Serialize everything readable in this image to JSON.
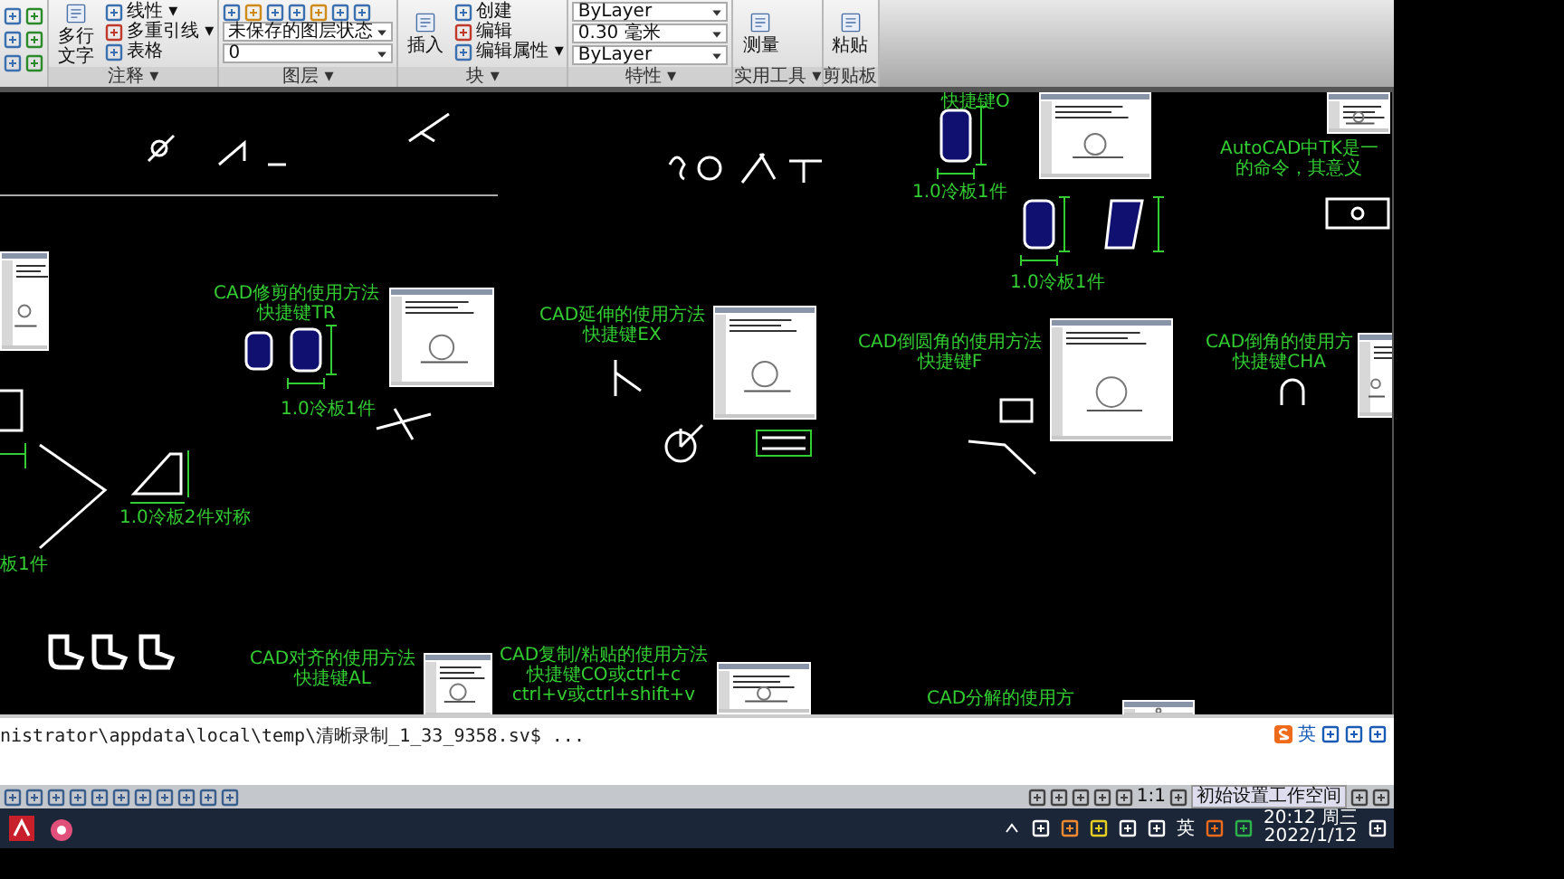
{
  "ribbon": {
    "panels": [
      {
        "title": "注释 ▾",
        "icon_row": false,
        "items": [
          {
            "kind": "large",
            "label": "多行文字"
          },
          {
            "kind": "small",
            "label": "线性 ▾"
          },
          {
            "kind": "small",
            "label": "多重引线 ▾"
          },
          {
            "kind": "small",
            "label": "表格"
          }
        ]
      },
      {
        "title": "图层 ▾",
        "icon_row": true,
        "items": [
          {
            "kind": "dropdown",
            "label": "未保存的图层状态"
          },
          {
            "kind": "dropdown",
            "label": "0"
          }
        ]
      },
      {
        "title": "块 ▾",
        "icon_row": false,
        "items": [
          {
            "kind": "large",
            "label": "插入"
          },
          {
            "kind": "small",
            "label": "创建"
          },
          {
            "kind": "small",
            "label": "编辑"
          },
          {
            "kind": "small",
            "label": "编辑属性 ▾"
          }
        ]
      },
      {
        "title": "特性 ▾",
        "icon_row": false,
        "items": [
          {
            "kind": "dropdown",
            "label": "ByLayer"
          },
          {
            "kind": "dropdown",
            "label": "0.30 毫米"
          },
          {
            "kind": "dropdown",
            "label": "ByLayer"
          }
        ]
      },
      {
        "title": "实用工具 ▾",
        "icon_row": false,
        "items": [
          {
            "kind": "large",
            "label": "测量"
          }
        ]
      },
      {
        "title": "剪贴板",
        "icon_row": false,
        "items": [
          {
            "kind": "large",
            "label": "粘贴"
          }
        ]
      }
    ]
  },
  "canvas": {
    "labels": [
      {
        "lines": [
          "快捷键O"
        ]
      },
      {
        "lines": [
          "1.0冷板1件"
        ]
      },
      {
        "lines": [
          "1.0冷板1件"
        ]
      },
      {
        "lines": [
          "AutoCAD中TK是一",
          "的命令，其意义"
        ]
      },
      {
        "lines": [
          "CAD修剪的使用方法",
          "快捷键TR"
        ]
      },
      {
        "lines": [
          "1.0冷板1件"
        ]
      },
      {
        "lines": [
          "CAD延伸的使用方法",
          "快捷键EX"
        ]
      },
      {
        "lines": [
          "CAD倒圆角的使用方法",
          "快捷键F"
        ]
      },
      {
        "lines": [
          "CAD倒角的使用方",
          "快捷键CHA"
        ]
      },
      {
        "lines": [
          "1.0冷板2件对称"
        ]
      },
      {
        "lines": [
          "板1件"
        ]
      },
      {
        "lines": [
          "CAD对齐的使用方法",
          "快捷键AL"
        ]
      },
      {
        "lines": [
          "CAD复制/粘贴的使用方法",
          "快捷键CO或ctrl+c",
          "ctrl+v或ctrl+shift+v"
        ]
      },
      {
        "lines": [
          "CAD分解的使用方"
        ]
      }
    ]
  },
  "command_line": {
    "history": "nistrator\\appdata\\local\\temp\\清晰录制_1_33_9358.sv$ ..."
  },
  "ime_bar": {
    "language": "英"
  },
  "status_bar": {
    "scale": "1:1",
    "workspace": "初始设置工作空间"
  },
  "taskbar": {
    "input_language": "英",
    "time": "20:12 周三",
    "date": "2022/1/12"
  }
}
